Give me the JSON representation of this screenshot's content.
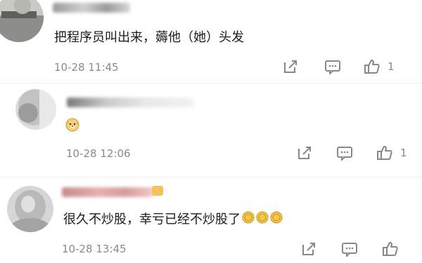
{
  "comments": [
    {
      "text": "把程序员叫出来，薅他（她）头发",
      "time": "10-28 11:45",
      "likes": "1",
      "share_icon": "share-arrow-icon",
      "reply_icon": "comment-bubble-icon",
      "like_icon": "thumbs-up-icon"
    },
    {
      "emoji": "doge-emoji",
      "time": "10-28 12:06",
      "likes": "1",
      "share_icon": "share-arrow-icon",
      "reply_icon": "comment-bubble-icon",
      "like_icon": "thumbs-up-icon"
    },
    {
      "text": "很久不炒股，幸亏已经不炒股了",
      "emojis": [
        "coin-emoji",
        "coin-emoji",
        "coin-emoji"
      ],
      "time": "10-28 13:45",
      "share_icon": "share-arrow-icon",
      "reply_icon": "comment-bubble-icon",
      "like_icon": "thumbs-up-icon"
    }
  ],
  "colors": {
    "meta_text": "#8a8a8a",
    "body_text": "#1a1a1a",
    "divider": "#ececec"
  }
}
